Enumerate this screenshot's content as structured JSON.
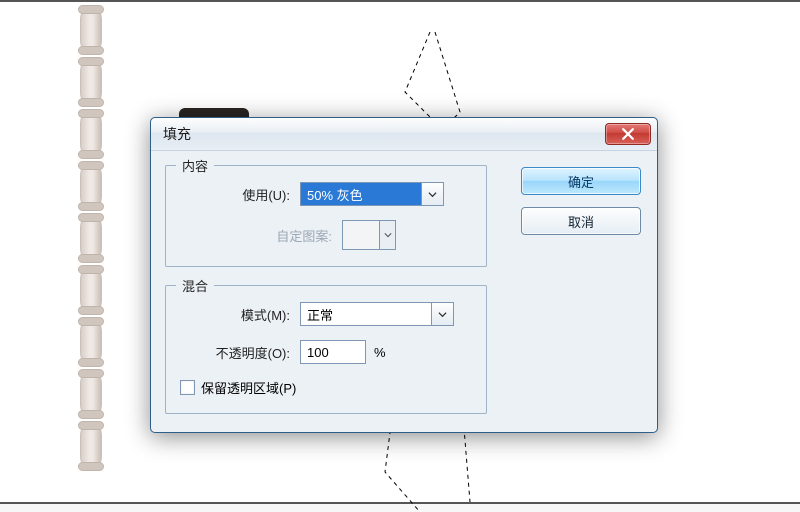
{
  "dialog": {
    "title": "填充",
    "close_icon": "close-icon"
  },
  "content_group": {
    "legend": "内容",
    "use_label": "使用(U):",
    "use_value": "50% 灰色",
    "pattern_label": "自定图案:"
  },
  "blend_group": {
    "legend": "混合",
    "mode_label": "模式(M):",
    "mode_value": "正常",
    "opacity_label": "不透明度(O):",
    "opacity_value": "100",
    "opacity_unit": "%",
    "preserve_label": "保留透明区域(P)",
    "preserve_checked": false
  },
  "buttons": {
    "ok": "确定",
    "cancel": "取消"
  }
}
